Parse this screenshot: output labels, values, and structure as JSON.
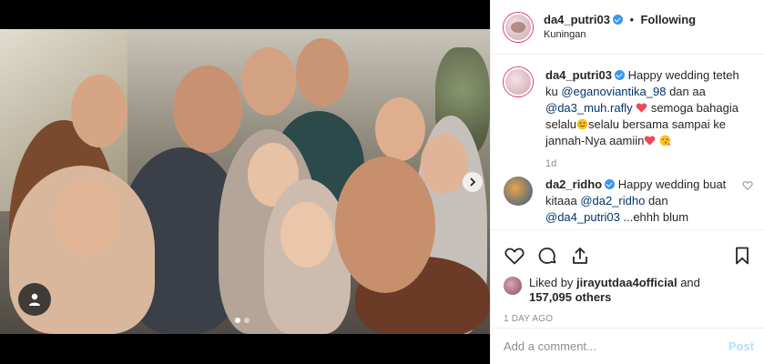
{
  "post": {
    "username": "da4_putri03",
    "follow_label": "Following",
    "location": "Kuningan",
    "separator": "•"
  },
  "caption": {
    "username": "da4_putri03",
    "text_1": "Happy wedding teteh ku ",
    "mention_1": "@eganoviantika_98",
    "text_2": " dan aa ",
    "mention_2": "@da3_muh.rafly",
    "text_3": " semoga bahagia selalu",
    "text_4": "selalu bersama sampai ke jannah-Nya aamiin",
    "time": "1d"
  },
  "reply": {
    "username": "da2_ridho",
    "text_1": "Happy wedding buat kitaaa ",
    "mention_1": "@da2_ridho",
    "text_2": " dan ",
    "mention_2": "@da4_putri03",
    "text_3": " ...ehhh blum"
  },
  "likes": {
    "prefix": "Liked by ",
    "user": "jirayutdaa4official",
    "middle": " and",
    "count": "157,095 others"
  },
  "date": "1 DAY AGO",
  "add_comment": {
    "placeholder": "Add a comment...",
    "post_label": "Post"
  },
  "colors": {
    "accent": "#3897f0",
    "heart": "#ed4956",
    "post_disabled": "#b2dffc",
    "muted": "#8e8e8e"
  },
  "icons": [
    "heart-icon",
    "comment-icon",
    "share-icon",
    "bookmark-icon",
    "user-tag-icon",
    "chevron-right-icon",
    "verified-icon"
  ],
  "carousel": {
    "total": 2,
    "active": 1
  }
}
